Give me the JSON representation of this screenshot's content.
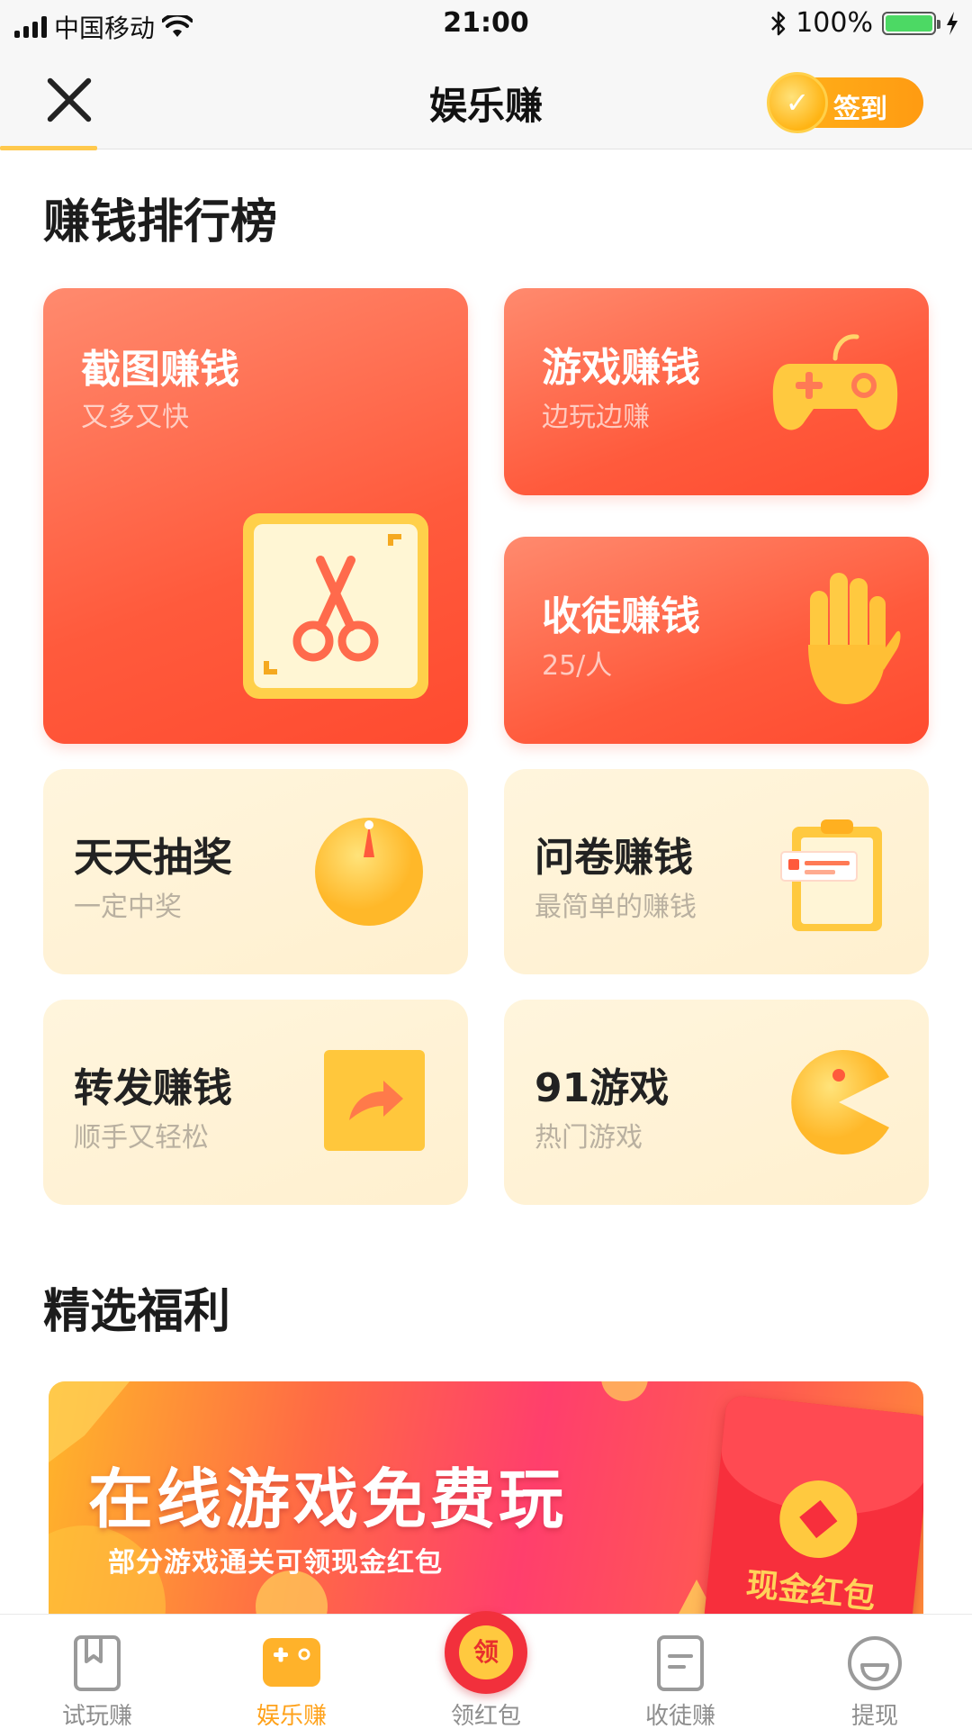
{
  "status_bar": {
    "carrier": "中国移动",
    "time": "21:00",
    "battery_percent": "100%",
    "battery_level": 1.0
  },
  "nav": {
    "title": "娱乐赚",
    "signin_label": "签到"
  },
  "sections": {
    "ranking_title": "赚钱排行榜",
    "welfare_title": "精选福利"
  },
  "cards": {
    "screenshot": {
      "title": "截图赚钱",
      "subtitle": "又多又快",
      "icon": "scissors-icon"
    },
    "game": {
      "title": "游戏赚钱",
      "subtitle": "边玩边赚",
      "icon": "gamepad-icon"
    },
    "apprentice": {
      "title": "收徒赚钱",
      "subtitle": "25/人",
      "icon": "hand-icon"
    },
    "lottery": {
      "title": "天天抽奖",
      "subtitle": "一定中奖",
      "icon": "wheel-icon"
    },
    "survey": {
      "title": "问卷赚钱",
      "subtitle": "最简单的赚钱",
      "icon": "clipboard-icon"
    },
    "share": {
      "title": "转发赚钱",
      "subtitle": "顺手又轻松",
      "icon": "share-arrow-icon"
    },
    "games91": {
      "title": "91游戏",
      "subtitle": "热门游戏",
      "icon": "pacman-icon"
    }
  },
  "banner": {
    "headline": "在线游戏免费玩",
    "subline": "部分游戏通关可领现金红包",
    "envelope_text": "现金红包"
  },
  "tabs": [
    {
      "label": "试玩赚",
      "icon": "bookmark-icon",
      "active": false
    },
    {
      "label": "娱乐赚",
      "icon": "game-icon",
      "active": true
    },
    {
      "label": "领红包",
      "icon": "red-packet-icon",
      "active": false,
      "badge": "领"
    },
    {
      "label": "收徒赚",
      "icon": "document-icon",
      "active": false
    },
    {
      "label": "提现",
      "icon": "smile-icon",
      "active": false
    }
  ],
  "colors": {
    "accent": "#ffa21b",
    "card_red": "#ff5a3c",
    "card_cream": "#fff3d6",
    "battery_green": "#4cd964"
  }
}
